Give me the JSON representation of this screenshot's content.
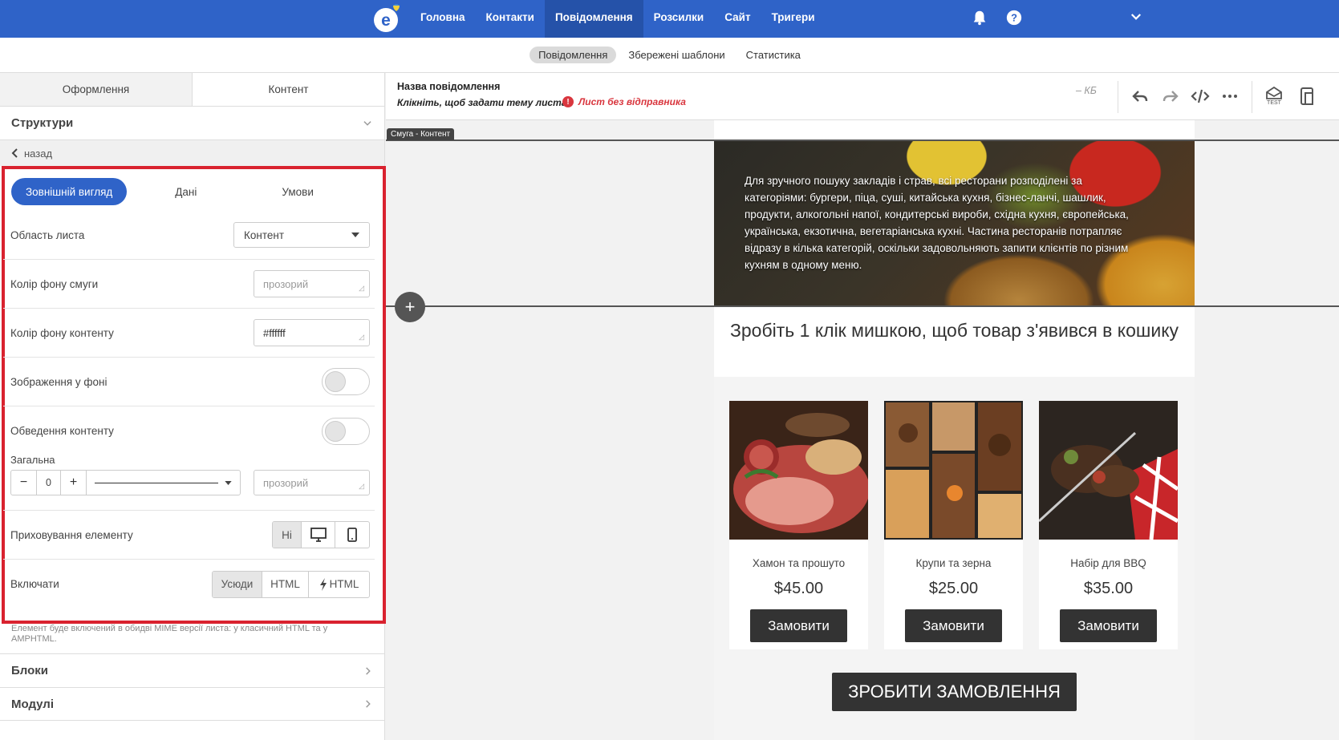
{
  "nav": {
    "items": [
      "Головна",
      "Контакти",
      "Повідомлення",
      "Розсилки",
      "Сайт",
      "Тригери"
    ],
    "active_index": 2
  },
  "subnav": {
    "items": [
      "Повідомлення",
      "Збережені шаблони",
      "Статистика"
    ],
    "active_index": 0
  },
  "left": {
    "tabs": [
      "Оформлення",
      "Контент"
    ],
    "structures_title": "Структури",
    "back_label": "назад",
    "modes": [
      "Зовнішній вигляд",
      "Дані",
      "Умови"
    ],
    "area_label": "Область листа",
    "area_value": "Контент",
    "band_bg_label": "Колір фону смуги",
    "band_bg_placeholder": "прозорий",
    "content_bg_label": "Колір фону контенту",
    "content_bg_value": "#ffffff",
    "bg_image_label": "Зображення у фоні",
    "border_label": "Обведення контенту",
    "general_label": "Загальна",
    "border_width": "0",
    "border_color_placeholder": "прозорий",
    "hide_label": "Приховування елементу",
    "hide_no": "Ні",
    "include_label": "Включати",
    "include_options": [
      "Усюди",
      "HTML",
      "HTML"
    ],
    "include_note": "Елемент буде включений в обидві MIME версії листа: у класичний HTML та у AMPHTML.",
    "blocks_label": "Блоки",
    "modules_label": "Модулі"
  },
  "editor": {
    "message_name": "Назва повідомлення",
    "subject_prompt": "Клікніть, щоб задати тему листа",
    "warning": "Лист без відправника",
    "size": "– КБ",
    "test_label": "TEST"
  },
  "email": {
    "band_tag": "Смуга - Контент",
    "hero_text": "Для зручного пошуку закладів і страв, всі ресторани розподілені за категоріями: бургери, піца, суші, китайська кухня, бізнес-ланчі, шашлик, продукти, алкогольні напої, кондитерські вироби, східна кухня, європейська, українська, екзотична, вегетаріанська кухні. Частина ресторанів потрапляє відразу в кілька категорій, оскільки задовольняють запити клієнтів по різним кухням в одному меню.",
    "heading": "Зробіть 1 клік мишкою, щоб товар з'явився в кошику",
    "products": [
      {
        "name": "Хамон та прошуто",
        "price": "$45.00",
        "button": "Замовити"
      },
      {
        "name": "Крупи та зерна",
        "price": "$25.00",
        "button": "Замовити"
      },
      {
        "name": "Набір для BBQ",
        "price": "$35.00",
        "button": "Замовити"
      }
    ],
    "order_button": "ЗРОБИТИ ЗАМОВЛЕННЯ"
  },
  "colors": {
    "brand": "#2f63c8",
    "highlight_frame": "#d9222f",
    "warning": "#d9363e"
  }
}
